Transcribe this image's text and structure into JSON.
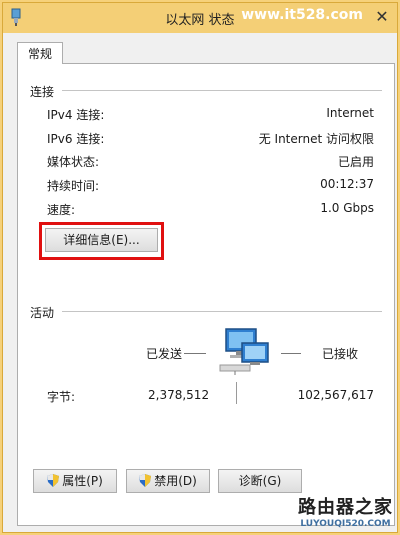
{
  "window": {
    "title": "以太网 状态",
    "watermark": "www.it528.com"
  },
  "tabs": [
    {
      "label": "常规"
    }
  ],
  "connection": {
    "heading": "连接",
    "rows": [
      {
        "label": "IPv4 连接:",
        "value": "Internet"
      },
      {
        "label": "IPv6 连接:",
        "value": "无 Internet 访问权限"
      },
      {
        "label": "媒体状态:",
        "value": "已启用"
      },
      {
        "label": "持续时间:",
        "value": "00:12:37"
      },
      {
        "label": "速度:",
        "value": "1.0 Gbps"
      }
    ],
    "details_button": "详细信息(E)..."
  },
  "activity": {
    "heading": "活动",
    "sent_label": "已发送",
    "received_label": "已接收",
    "bytes_label": "字节:",
    "bytes_sent": "2,378,512",
    "bytes_received": "102,567,617"
  },
  "buttons": {
    "properties": "属性(P)",
    "disable": "禁用(D)",
    "diagnose": "诊断(G)"
  },
  "footer_watermark": {
    "main": "路由器之家",
    "sub": "LUYOUQI520.COM"
  },
  "colors": {
    "titlebar": "#f4cf76",
    "highlight": "#e01010"
  }
}
